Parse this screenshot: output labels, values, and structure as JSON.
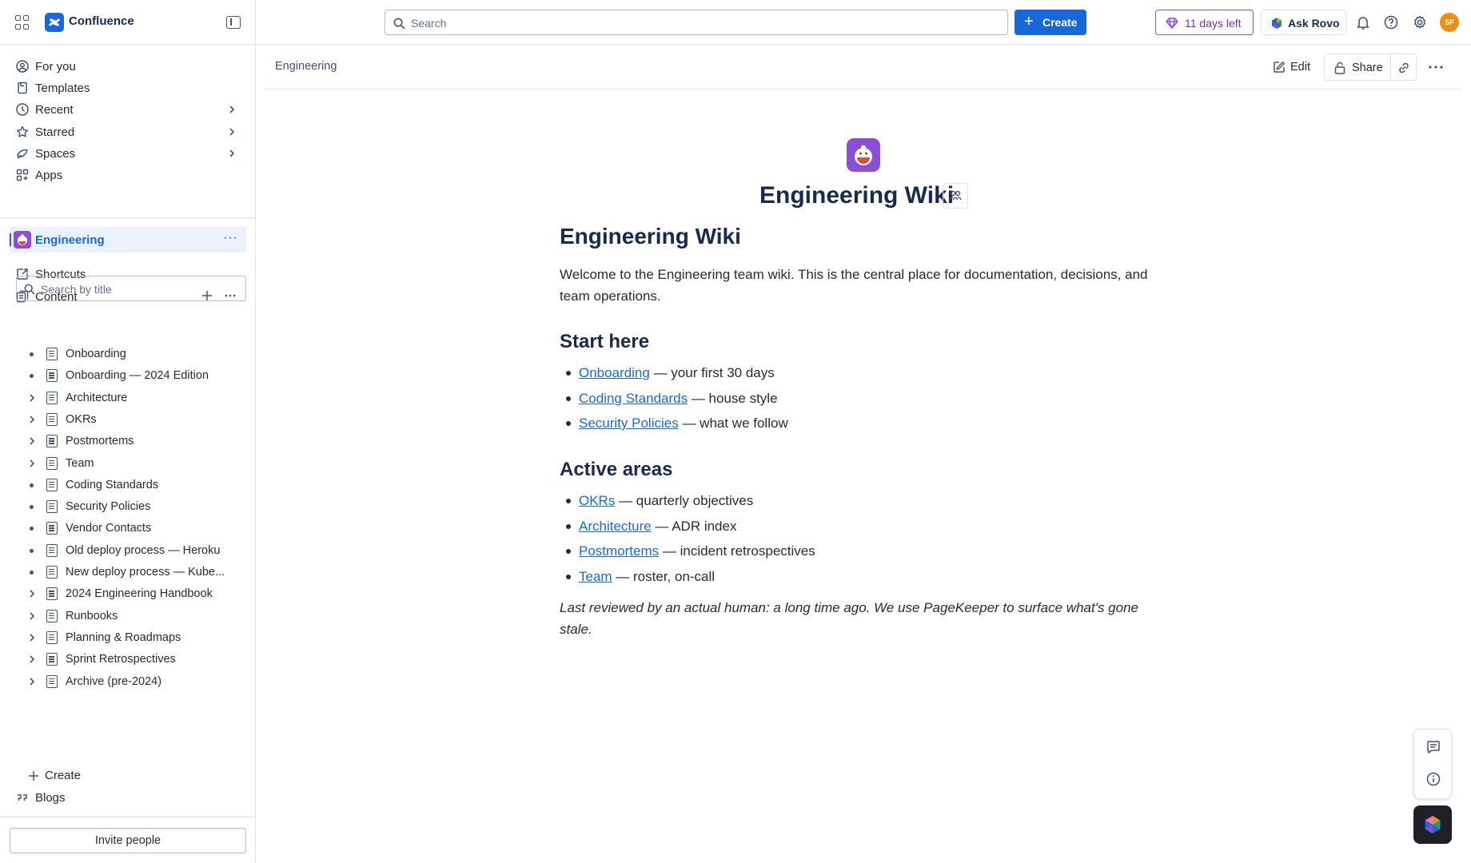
{
  "app": {
    "name": "Confluence"
  },
  "topbar": {
    "search_placeholder": "Search",
    "create_label": "Create",
    "trial_label": "11 days left",
    "rovo_label": "Ask Rovo",
    "avatar_initials": "SF",
    "accent": "#1868db"
  },
  "sidebar": {
    "nav": [
      {
        "label": "For you",
        "icon": "person-circle-icon"
      },
      {
        "label": "Templates",
        "icon": "template-icon"
      },
      {
        "label": "Recent",
        "icon": "clock-icon"
      },
      {
        "label": "Starred",
        "icon": "star-icon"
      },
      {
        "label": "Spaces",
        "icon": "spaces-icon"
      },
      {
        "label": "Apps",
        "icon": "apps-icon"
      }
    ],
    "space": {
      "label": "Engineering",
      "more": "···"
    },
    "shortcuts_label": "Shortcuts",
    "content_label": "Content",
    "tree_search_placeholder": "Search by title",
    "tree": [
      {
        "label": "Onboarding",
        "has_children": false
      },
      {
        "label": "Onboarding — 2024 Edition",
        "has_children": false
      },
      {
        "label": "Architecture",
        "has_children": true
      },
      {
        "label": "OKRs",
        "has_children": true
      },
      {
        "label": "Postmortems",
        "has_children": true
      },
      {
        "label": "Team",
        "has_children": true
      },
      {
        "label": "Coding Standards",
        "has_children": false
      },
      {
        "label": "Security Policies",
        "has_children": false
      },
      {
        "label": "Vendor Contacts",
        "has_children": false
      },
      {
        "label": "Old deploy process — Heroku",
        "has_children": false
      },
      {
        "label": "New deploy process — Kube...",
        "has_children": false
      },
      {
        "label": "2024 Engineering Handbook",
        "has_children": true
      },
      {
        "label": "Runbooks",
        "has_children": true
      },
      {
        "label": "Planning & Roadmaps",
        "has_children": true
      },
      {
        "label": "Sprint Retrospectives",
        "has_children": true
      },
      {
        "label": "Archive (pre-2024)",
        "has_children": true
      }
    ],
    "tree_create_label": "Create",
    "blogs_label": "Blogs",
    "invite_label": "Invite people"
  },
  "page": {
    "breadcrumb": "Engineering",
    "edit_label": "Edit",
    "share_label": "Share",
    "title": "Engineering Wiki",
    "heading": "Engineering Wiki",
    "intro": "Welcome to the Engineering team wiki. This is the central place for documentation, decisions, and team operations.",
    "sections": [
      {
        "heading": "Start here",
        "items": [
          {
            "link": "Onboarding",
            "text": " — your first 30 days"
          },
          {
            "link": "Coding Standards",
            "text": " — house style"
          },
          {
            "link": "Security Policies",
            "text": " — what we follow"
          }
        ]
      },
      {
        "heading": "Active areas",
        "items": [
          {
            "link": "OKRs",
            "text": " — quarterly objectives"
          },
          {
            "link": "Architecture",
            "text": " — ADR index"
          },
          {
            "link": "Postmortems",
            "text": " — incident retrospectives"
          },
          {
            "link": "Team",
            "text": " — roster, on-call"
          }
        ]
      }
    ],
    "note": "Last reviewed by an actual human: a long time ago. We use PageKeeper to surface what's gone stale."
  }
}
